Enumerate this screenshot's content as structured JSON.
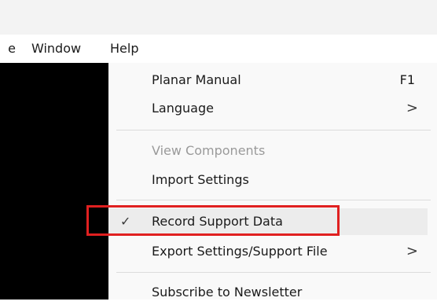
{
  "menubar": {
    "items": [
      {
        "label": "e"
      },
      {
        "label": "Window"
      },
      {
        "label": "Help"
      }
    ]
  },
  "help_menu": {
    "entries": [
      {
        "label": "Planar Manual",
        "shortcut": "F1"
      },
      {
        "label": "Language",
        "submenu_icon": ">"
      },
      {
        "label": "View Components",
        "state": "disabled"
      },
      {
        "label": "Import Settings"
      },
      {
        "label": "Record Support Data",
        "checked": true,
        "check_icon": "✓"
      },
      {
        "label": "Export Settings/Support File",
        "submenu_icon": ">"
      },
      {
        "label": "Subscribe to Newsletter"
      }
    ]
  },
  "annotation": {
    "color": "#e02020",
    "target": "Record Support Data"
  }
}
